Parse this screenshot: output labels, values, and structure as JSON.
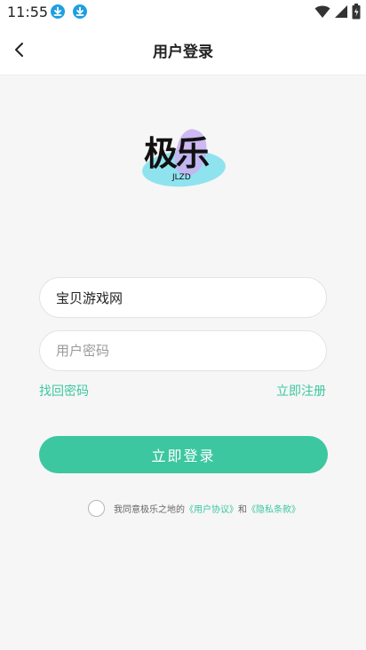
{
  "status_bar": {
    "time": "11:55"
  },
  "header": {
    "title": "用户登录"
  },
  "logo": {
    "text": "极乐",
    "subtitle": "JLZD"
  },
  "form": {
    "username_value": "宝贝游戏网",
    "password_placeholder": "用户密码",
    "forgot_password_label": "找回密码",
    "register_label": "立即注册",
    "login_label": "立即登录"
  },
  "agreement": {
    "prefix": "我同意极乐之地的",
    "user_agreement": "《用户协议》",
    "and": "和",
    "privacy_policy": "《隐私条款》"
  },
  "colors": {
    "accent": "#3cc7a0",
    "download_icon": "#1e9fe0"
  }
}
